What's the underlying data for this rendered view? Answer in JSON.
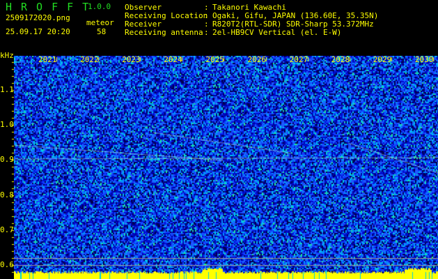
{
  "header": {
    "app_name": "HROFFT",
    "version": "1.0.0",
    "filename": "2509172020.png",
    "datetime": "25.09.17 20:20",
    "count_label": "meteor",
    "count_value": "58"
  },
  "station": {
    "rows": [
      {
        "label": "Observer",
        "value": "Takanori Kawachi"
      },
      {
        "label": "Receiving Location",
        "value": "Ogaki, Gifu, JAPAN (136.60E, 35.35N)"
      },
      {
        "label": "Receiver",
        "value": "R820T2(RTL-SDR) SDR-Sharp 53.372MHz"
      },
      {
        "label": "Receiving antenna",
        "value": "2el-HB9CV Vertical (el. E-W)"
      }
    ],
    "separator": ":"
  },
  "spectrogram": {
    "y_unit": "kHz",
    "y_ticks": [
      "1.1",
      "1.0",
      "0.9",
      "0.8",
      "0.7",
      "0.6"
    ],
    "x_ticks": [
      "2021",
      "2022",
      "2023",
      "2024",
      "2025",
      "2026",
      "2027",
      "2028",
      "2029",
      "2030"
    ],
    "colors": {
      "background": "#000000",
      "text": "#ffff00",
      "title": "#22dd22",
      "noise_low": "#0000a0",
      "noise_mid": "#1e5aff",
      "noise_high": "#00e0e0",
      "signal": "#00ff60",
      "baseline": "#ffff00",
      "reference_line": "#9a9a9a"
    }
  }
}
